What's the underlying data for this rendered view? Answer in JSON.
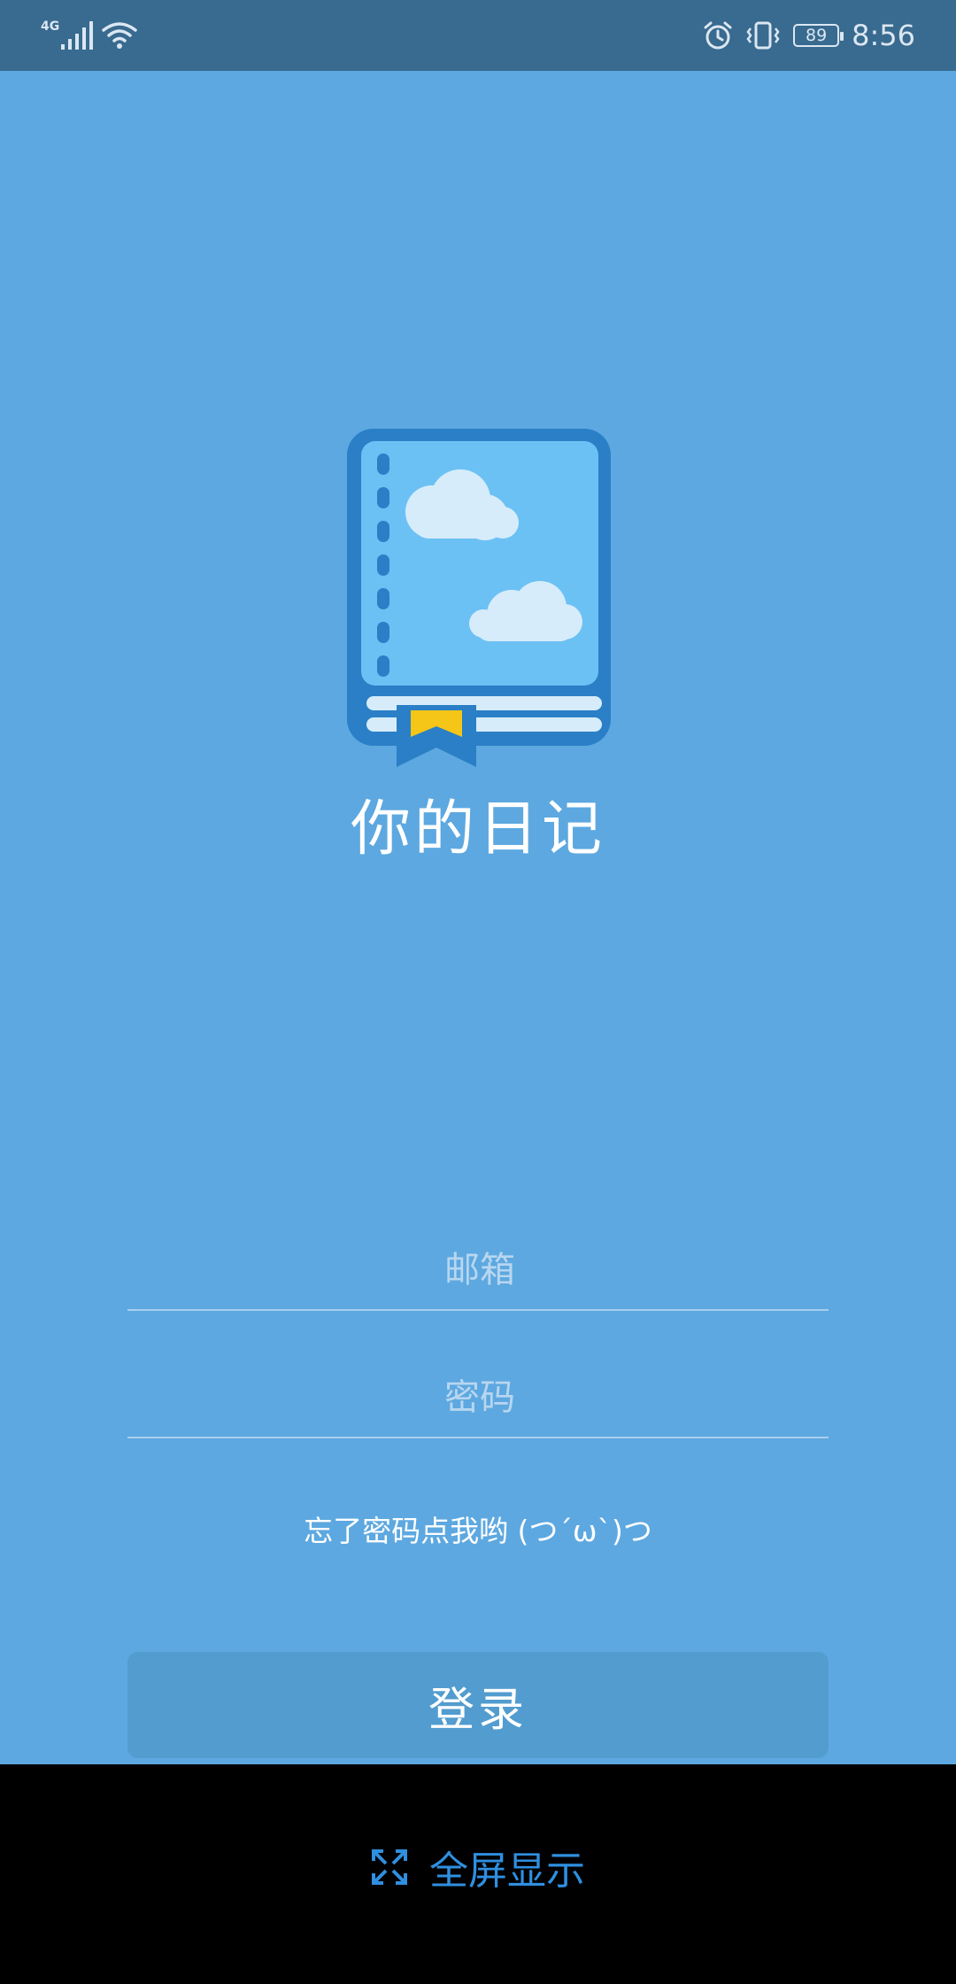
{
  "status_bar": {
    "network_type": "4G",
    "battery_level": "89",
    "time": "8:56",
    "icons": [
      "signal-icon",
      "wifi-icon",
      "alarm-icon",
      "vibrate-icon",
      "battery-icon"
    ]
  },
  "app": {
    "title": "你的日记",
    "logo_icon": "diary-book-icon"
  },
  "login_form": {
    "email_placeholder": "邮箱",
    "password_placeholder": "密码",
    "forgot_password_text": "忘了密码点我哟 (つ´ω`)つ",
    "login_button_label": "登录"
  },
  "bottom_bar": {
    "fullscreen_label": "全屏显示",
    "fullscreen_icon": "expand-icon"
  },
  "colors": {
    "background": "#5da8e0",
    "status_bar": "#396a8f",
    "login_button": "#529ccf",
    "fullscreen_text": "#2f8fe0"
  }
}
